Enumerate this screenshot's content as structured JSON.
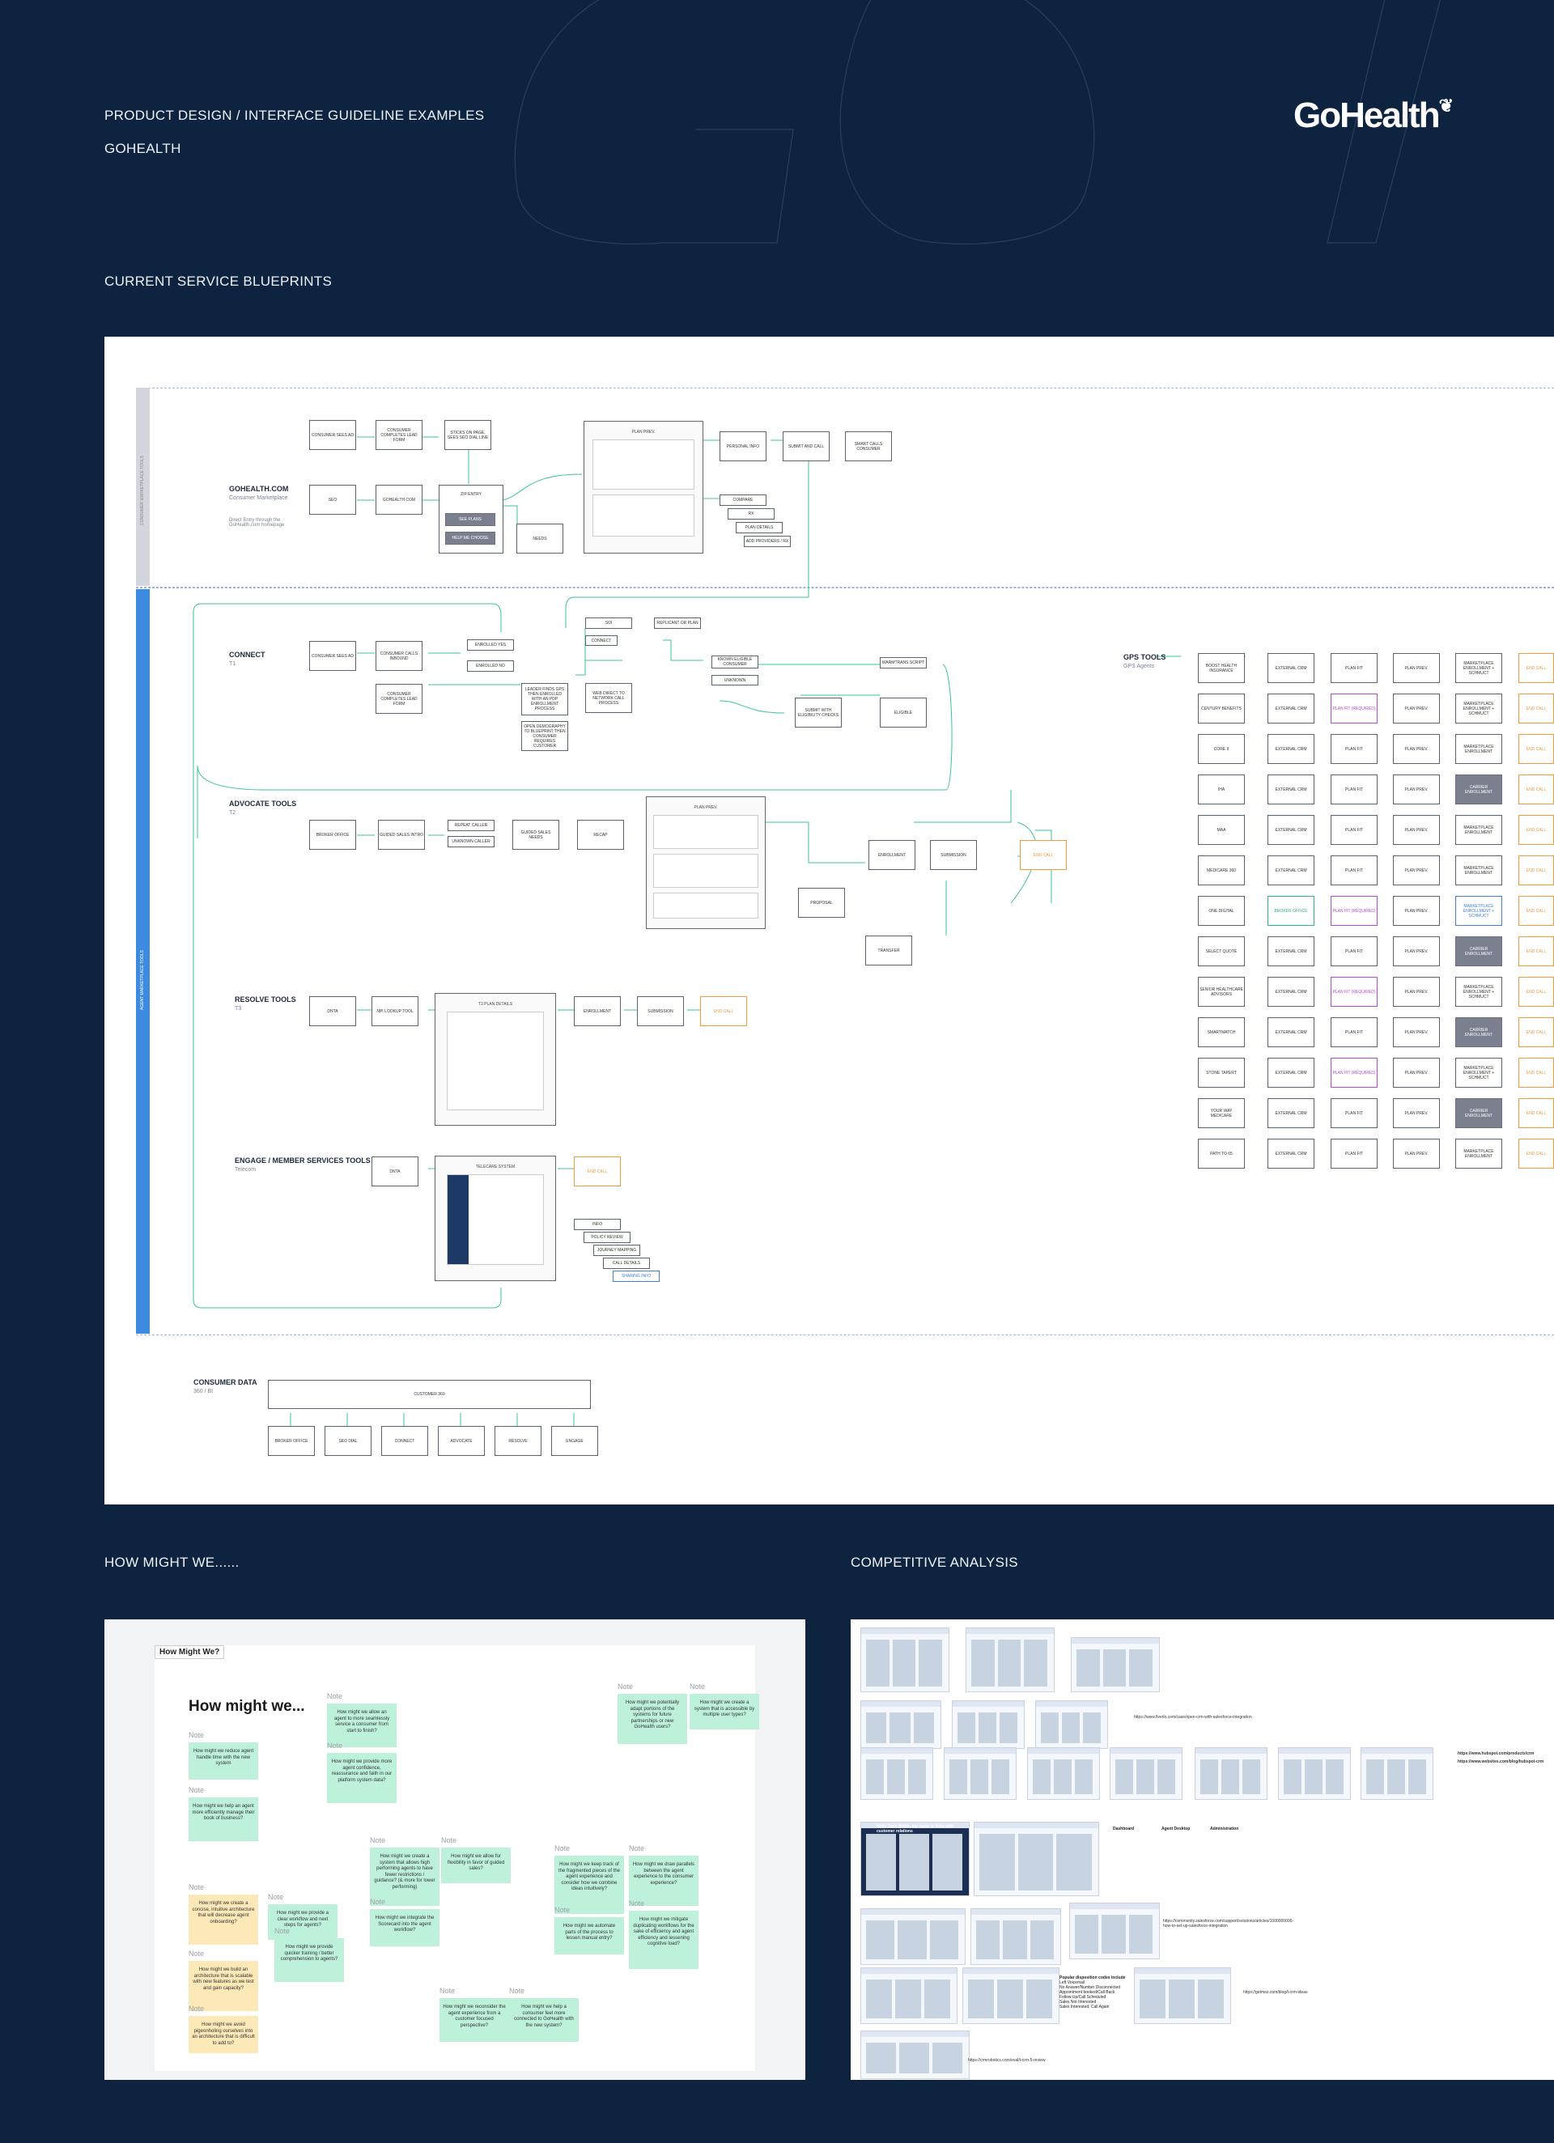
{
  "header": {
    "title": "PRODUCT DESIGN / INTERFACE GUIDELINE EXAMPLES",
    "company": "GOHEALTH",
    "logo_text": "GoHealth"
  },
  "sections": {
    "blueprints": "CURRENT SERVICE BLUEPRINTS",
    "hmw": "HOW MIGHT WE......",
    "competitive": "COMPETITIVE ANALYSIS"
  },
  "blueprint": {
    "strip_labels": [
      "CONSUMER MARKETPLACE TOOLS",
      "AGENT MARKETPLACE TOOLS"
    ],
    "lanes": {
      "gohealth": {
        "title": "GOHEALTH.COM",
        "sub": "Consumer Marketplace",
        "note": "Direct Entry through the GoHealth.com homepage"
      },
      "connect": {
        "title": "CONNECT",
        "sub": "T1"
      },
      "advocate": {
        "title": "ADVOCATE TOOLS",
        "sub": "T2"
      },
      "resolve": {
        "title": "RESOLVE TOOLS",
        "sub": "T3"
      },
      "engage": {
        "title": "ENGAGE / MEMBER SERVICES TOOLS",
        "sub": "Telecom"
      },
      "gps": {
        "title": "GPS TOOLS",
        "sub": "GPS Agents"
      },
      "consumer": {
        "title": "CONSUMER DATA",
        "sub": "360 / BI"
      }
    },
    "gohealth_boxes": [
      "CONSUMER SEES AD",
      "CONSUMER COMPLETES LEAD FORM",
      "STICKS ON PAGE, SEES SEO DIAL LINE",
      "SEO",
      "GOHEALTH.COM",
      "ZIP ENTRY",
      "SEE PLANS",
      "HELP ME CHOOSE",
      "NEEDS",
      "PERSONAL INFO",
      "SUBMIT AND CALL",
      "SMART CALLS CONSUMER",
      "COMPARE",
      "RX",
      "PLAN DETAILS",
      "ADD PROVIDERS / RX"
    ],
    "gohealth_mock": "PLAN PREV.",
    "connect_boxes": [
      "CONSUMER SEES AD",
      "CONSUMER CALLS INBOUND",
      "CONSUMER COMPLETES LEAD FORM",
      "ENROLLED YES",
      "ENROLLED NO",
      "SOI",
      "CONNECT",
      "REPLICANT OR PLAN",
      "LEADER FINDS GPS THEN ENROLLED WITH AN PDP ENROLLMENT PROCESS",
      "WEB DIRECT TO NETWORK CALL PROCESS",
      "OPEN DEMOGRAPHY TO BLUEPRINT THEN CONSUMER REQUIRES CUSTOMER",
      "KNOWN ELIGIBLE CONSUMER",
      "UNKNOWN",
      "SUBMIT WITH ELIGIBILITY CHECKS",
      "ELIGIBLE",
      "WARMTRANS SCRIPT"
    ],
    "advocate_boxes": [
      "BROKER OFFICE",
      "GUIDED SALES INTRO",
      "REPEAT CALLER",
      "UNKNOWN CALLER",
      "GUIDED SALES NEEDS",
      "RECAP",
      "ENROLLMENT",
      "SUBMISSION",
      "PROPOSAL",
      "TRANSFER",
      "END CALL"
    ],
    "advocate_mock": "PLAN PREV.",
    "resolve_boxes": [
      "DNTA",
      "NPI LOOKUP TOOL",
      "ENROLLMENT",
      "SUBMISSION",
      "END CALL"
    ],
    "resolve_mock": "T3 PLAN DETAILS",
    "engage_boxes": [
      "DNTA",
      "END CALL",
      "INFO",
      "POLICY REVIEW",
      "JOURNEY MAPPING",
      "CALL DETAILS",
      "SHARING INFO"
    ],
    "engage_mock": "TELECARE SYSTEM",
    "gps_rows": [
      [
        "BOOST HEALTH INSURANCE",
        "EXTERNAL CRM",
        "PLAN FIT",
        "PLAN PREV.",
        "MARKETPLACE ENROLLMENT + SCHMUCT",
        "END CALL"
      ],
      [
        "CENTURY BENEFITS",
        "EXTERNAL CRM",
        "PLAN FIT (REQUIRED)",
        "PLAN PREV.",
        "MARKETPLACE ENROLLMENT + SCHMUCT",
        "END CALL"
      ],
      [
        "CORE II",
        "EXTERNAL CRM",
        "PLAN FIT",
        "PLAN PREV.",
        "MARKETPLACE ENROLLMENT",
        "END CALL"
      ],
      [
        "IHA",
        "EXTERNAL CRM",
        "PLAN FIT",
        "PLAN PREV.",
        "CARRIER ENROLLMENT",
        "END CALL"
      ],
      [
        "MAA",
        "EXTERNAL CRM",
        "PLAN FIT",
        "PLAN PREV.",
        "MARKETPLACE ENROLLMENT",
        "END CALL"
      ],
      [
        "MEDICARE 360",
        "EXTERNAL CRM",
        "PLAN FIT",
        "PLAN PREV.",
        "MARKETPLACE ENROLLMENT",
        "END CALL"
      ],
      [
        "ONE DIGITAL",
        "BROKER OFFICE",
        "PLAN FIT (REQUIRED)",
        "PLAN PREV.",
        "MARKETPLACE ENROLLMENT + SCHMUCT",
        "END CALL"
      ],
      [
        "SELECT QUOTE",
        "EXTERNAL CRM",
        "PLAN FIT",
        "PLAN PREV.",
        "CARRIER ENROLLMENT",
        "END CALL"
      ],
      [
        "SENIOR HEALTHCARE ADVISORS",
        "EXTERNAL CRM",
        "PLAN FIT (REQUIRED)",
        "PLAN PREV.",
        "MARKETPLACE ENROLLMENT + SCHMUCT",
        "END CALL"
      ],
      [
        "SMARTMATCH",
        "EXTERNAL CRM",
        "PLAN FIT",
        "PLAN PREV.",
        "CARRIER ENROLLMENT",
        "END CALL"
      ],
      [
        "STONE TAPERT",
        "EXTERNAL CRM",
        "PLAN FIT (REQUIRED)",
        "PLAN PREV.",
        "MARKETPLACE ENROLLMENT + SCHMUCT",
        "END CALL"
      ],
      [
        "YOUR WAY MEDICARE",
        "EXTERNAL CRM",
        "PLAN FIT",
        "PLAN PREV.",
        "CARRIER ENROLLMENT",
        "END CALL"
      ],
      [
        "PATH TO 65",
        "EXTERNAL CRM",
        "PLAN FIT",
        "PLAN PREV.",
        "MARKETPLACE ENROLLMENT",
        "END CALL"
      ]
    ],
    "consumer_data": {
      "top": "CUSTOMER 360",
      "items": [
        "BROKER OFFICE",
        "SEO DIAL",
        "CONNECT",
        "ADVOCATE",
        "RESOLVE",
        "ENGAGE"
      ]
    }
  },
  "hmw": {
    "badge": "How Might We?",
    "heading": "How might we...",
    "note_label": "Note",
    "cards": [
      "How might we reduce agent handle time with the new system",
      "How might we help an agent more efficiently manage their book of business?",
      "How might we allow an agent to more seamlessly service a consumer from start to finish?",
      "How might we provide more agent confidence, reassurance and faith in our platform system data?",
      "How might we potentially adapt portions of the systems for future partnerships or new GoHealth users?",
      "How might we create a system that is accessible by multiple user types?",
      "How might we create a system that allows high performing agents to have fewer restrictions / guidance? (& more for lower performing)",
      "How might we allow for flexibility in favor of guided sales?",
      "How might we integrate the Scorecard into the agent workflow?",
      "How might we create a concise, intuitive architecture that will decrease agent onboarding?",
      "How might we build an architecture that is scalable with new features as we test and gain capacity?",
      "How might we avoid pigeonholing ourselves into an architecture that is difficult to add to?",
      "How might we provide a clear workflow and next steps for agents?",
      "How might we provide quicker training / better comprehension to agents?",
      "How might we keep track of the fragmented pieces of the agent experience and consider how we combine ideas intuitively?",
      "How might we draw parallels between the agent experience to the consumer experience?",
      "How might we automate parts of the process to lessen manual entry?",
      "How might we mitigate duplicating workflows for the sake of efficiency and agent efficiency and lessening cognitive load?",
      "How might we reconsider the agent experience from a customer focused perspective?",
      "How might we help a consumer feel more connected to GoHealth with the new system?"
    ]
  },
  "competitive": {
    "urls": [
      "https://www.fiverlo.com/case/open-crm-with-salesforce-integration",
      "https://www.hubspot.com/products/crm",
      "https://www.websites.com/blog/hubspot-crm",
      "https://community.salesforce.com/support/solutions/articles/1000000000-how-to-set-up-salesforce-integration",
      "https://getmoz.com/blog/t-crm-ideas",
      "https://crmrobotics.com/eval/t-crm-5-review"
    ],
    "disposition_title": "Popular disposition codes include",
    "disposition_items": [
      "Left Voicemail",
      "No Answer/Number Disconnected",
      "Appointment booked/Call Back",
      "Follow Up/Call Scheduled",
      "Sales Not Interested",
      "Sales Interested, Call Again"
    ],
    "chat_title": "Hello Dave Smith, my name is Tuka with customer relations",
    "panels": [
      "Dashboard",
      "Agent Desktop",
      "Administration"
    ]
  }
}
